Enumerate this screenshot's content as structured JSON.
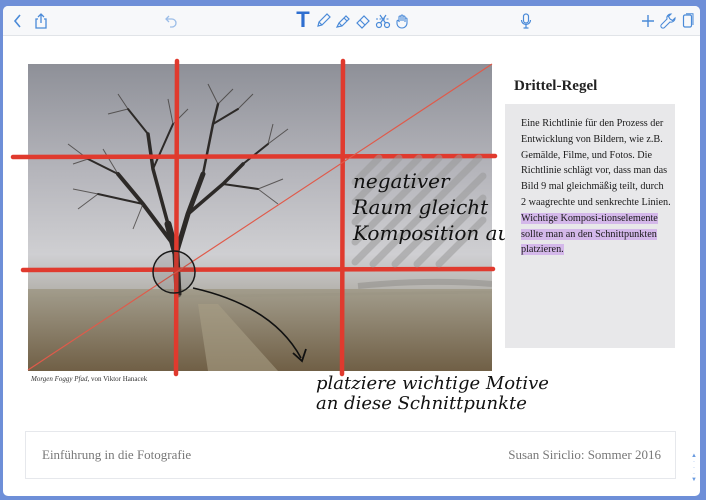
{
  "toolbar": {
    "items": [
      {
        "name": "back-button",
        "icon": "chevron-left-icon"
      },
      {
        "name": "share-button",
        "icon": "share-icon"
      },
      {
        "name": "undo-button",
        "icon": "undo-icon"
      },
      {
        "name": "text-tool-button",
        "icon": "text-tool-icon",
        "label": "T"
      },
      {
        "name": "pen-tool-button",
        "icon": "pen-icon"
      },
      {
        "name": "highlighter-tool-button",
        "icon": "highlighter-icon"
      },
      {
        "name": "eraser-tool-button",
        "icon": "eraser-icon"
      },
      {
        "name": "scissors-tool-button",
        "icon": "scissors-icon"
      },
      {
        "name": "hand-tool-button",
        "icon": "hand-icon"
      },
      {
        "name": "microphone-button",
        "icon": "microphone-icon"
      },
      {
        "name": "add-button",
        "icon": "plus-icon"
      },
      {
        "name": "settings-button",
        "icon": "wrench-icon"
      },
      {
        "name": "pages-button",
        "icon": "pages-icon"
      }
    ],
    "accent": "#4a8ad8",
    "text_tool_color": "#2f6fd0"
  },
  "photo": {
    "caption_title": "Morgen Foggy Pfad",
    "caption_rest": ", von Viktor Hanacek"
  },
  "side": {
    "title": "Drittel-Regel",
    "text_plain": "Eine Richtlinie für den Prozess der Entwicklung von Bildern, wie z.B. Gemälde, Filme, und Fotos. Die Richtlinie schlägt vor, dass man das Bild 9 mal gleichmäßig teilt, durch 2 waagrechte und senkrechte Linien. ",
    "text_highlighted": "Wichtige Komposi-tionselemente sollte man an den Schnittpunkten platzieren.",
    "highlight_color": "#d4b8ea"
  },
  "annotations": {
    "negative_space": [
      "negativer",
      "Raum gleicht",
      "Komposition aus"
    ],
    "intersections": [
      "platziere wichtige Motive",
      "an diese Schnittpunkte"
    ],
    "grid_color": "#e03a2e"
  },
  "footer": {
    "left": "Einführung in die Fotografie",
    "right": "Susan Siriclio: Sommer 2016"
  }
}
